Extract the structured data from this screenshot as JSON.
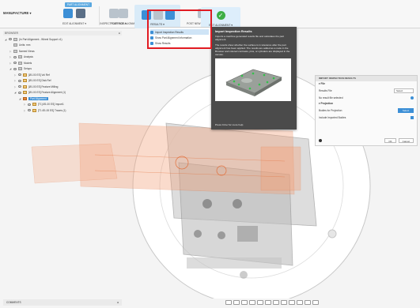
{
  "toolbar": {
    "workspace": "MANUFACTURE",
    "highlight_tab": "PART ALIGNMENT",
    "groups": [
      {
        "label": "EDIT ALIGNMENT"
      },
      {
        "label": "INSPECT SURFACE"
      },
      {
        "label": "POST FOR ALIGNMENT"
      },
      {
        "label": "RESULTS"
      },
      {
        "label": "POST NEW ALIGNMENT"
      },
      {
        "label": "EXIT ALIGNMENT"
      }
    ]
  },
  "dropdown": {
    "items": [
      {
        "label": "Import Inspection Results"
      },
      {
        "label": "Show Part Alignment Information"
      },
      {
        "label": "Show Results"
      }
    ]
  },
  "tooltip": {
    "title": "Import Inspection Results",
    "desc1": "Imports a machine generated results file and calculates the part alignment.",
    "desc2": "The results show whether the surface is in tolerance after the part alignment has been applied. The results are added as a node in the Browser and colored contrasts, pins, or cylinders are displayed in the canvas.",
    "hint": "Press Ctrl+/ for more help"
  },
  "browser": {
    "header": "BROWSER",
    "rows": [
      {
        "label": "(In Part Alignment - Wheel Support v1)"
      },
      {
        "label": "Units: mm"
      },
      {
        "label": "Named Views"
      },
      {
        "label": "Analysis"
      },
      {
        "label": "Models"
      },
      {
        "label": "Setups"
      },
      {
        "label": "[Ø1.00 ES] Vol Ref"
      },
      {
        "label": "[Ø1.00 ES] Disk Ref"
      },
      {
        "label": "[Ø1.00 ES] Feature Milling"
      },
      {
        "label": "[Ø1.00 ES] Feature Alignment (1)"
      },
      {
        "label": "Part Alignment"
      },
      {
        "label": "[T1] Ø1.00 ES] Import1"
      },
      {
        "label": "[T1 Ø1.00 ES] Traces (1)"
      }
    ]
  },
  "props": {
    "title": "IMPORT INSPECTION RESULTS",
    "file_section": "File",
    "results_file_label": "Results File",
    "select_label": "Select",
    "no_result": "No result file selected",
    "projection_section": "Projection",
    "bodies_label": "Bodies for Projection",
    "select2": "Select",
    "include_label": "Include Imported Bodies",
    "ok": "OK",
    "cancel": "Cancel"
  },
  "comments": {
    "label": "COMMENTS"
  },
  "colors": {
    "accent": "#3c8fd6",
    "highlight": "#e11b22",
    "success": "#3cae45"
  }
}
